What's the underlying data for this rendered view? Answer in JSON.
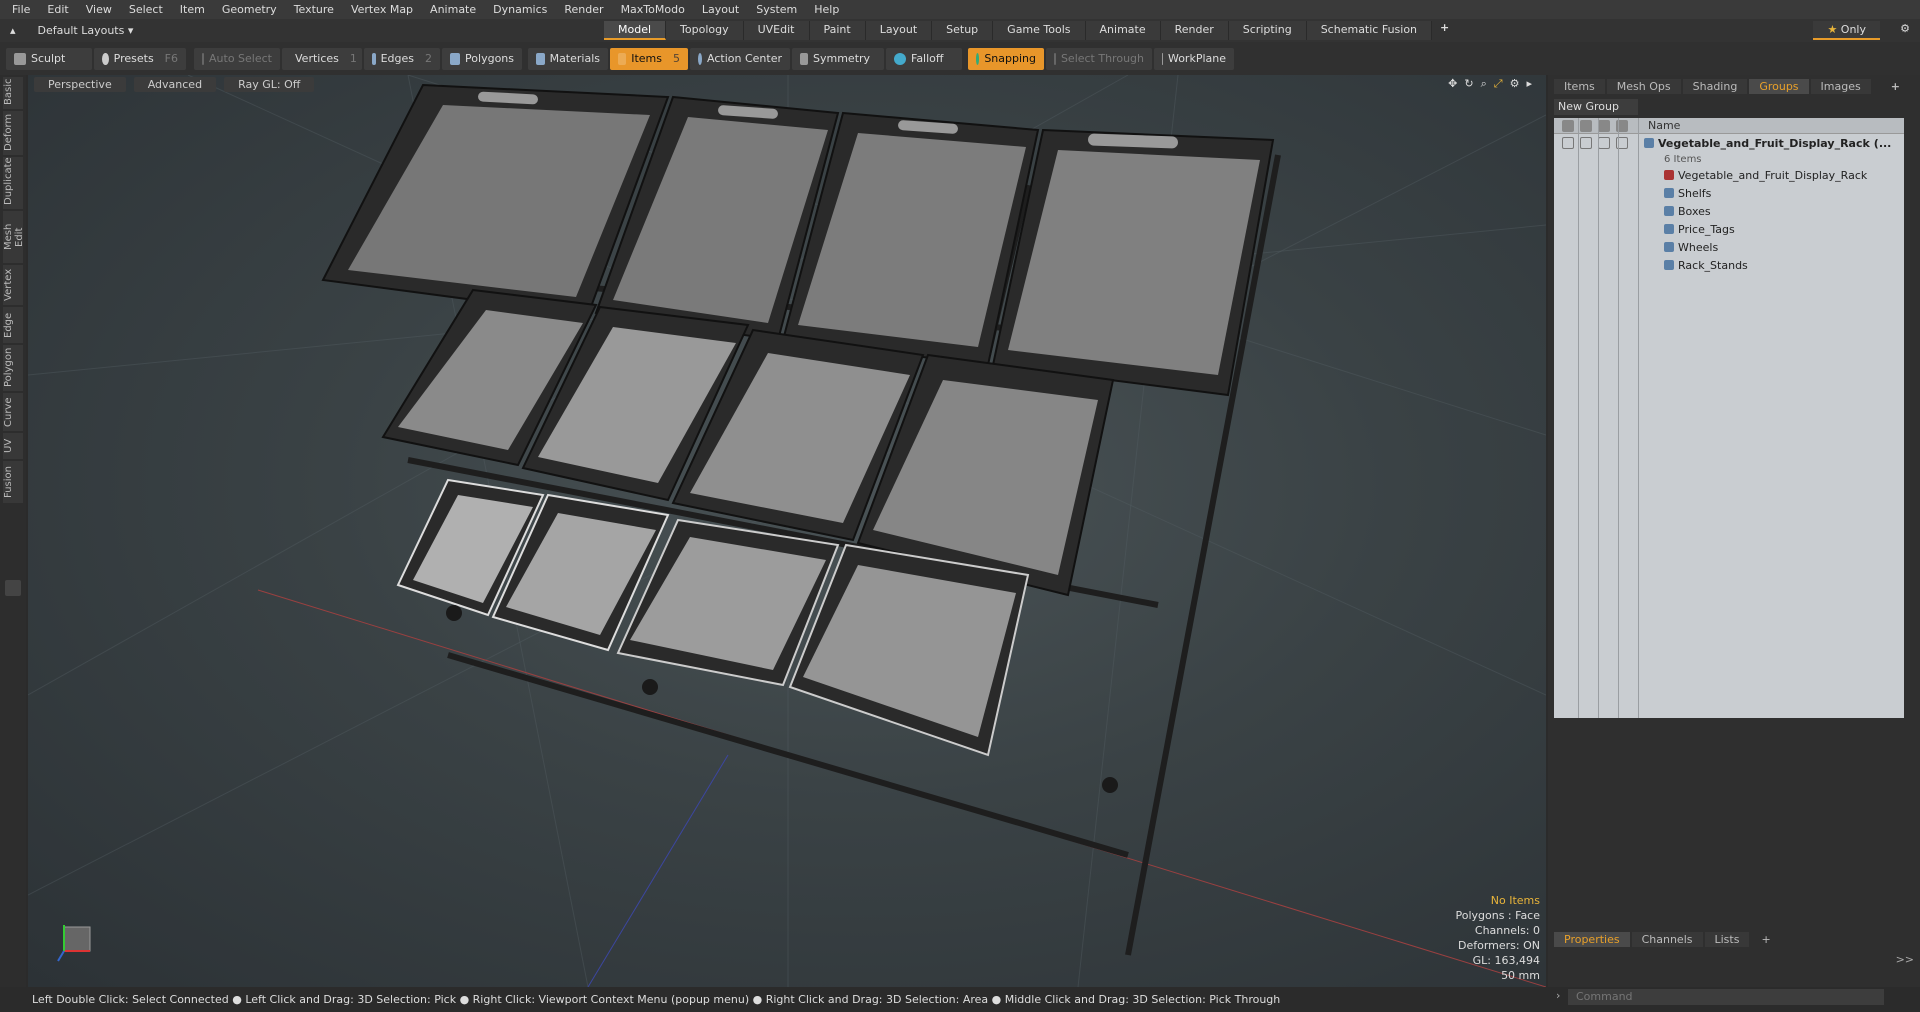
{
  "menu": [
    "File",
    "Edit",
    "View",
    "Select",
    "Item",
    "Geometry",
    "Texture",
    "Vertex Map",
    "Animate",
    "Dynamics",
    "Render",
    "MaxToModo",
    "Layout",
    "System",
    "Help"
  ],
  "layout_selector": "Default Layouts",
  "layout_tabs": [
    "Model",
    "Topology",
    "UVEdit",
    "Paint",
    "Layout",
    "Setup",
    "Game Tools",
    "Animate",
    "Render",
    "Scripting",
    "Schematic Fusion"
  ],
  "active_layout_tab": "Model",
  "only_button": "Only",
  "toolbar": [
    {
      "label": "Sculpt",
      "key": ""
    },
    {
      "label": "Presets",
      "key": "F6"
    },
    {
      "label": "Auto Select",
      "key": "",
      "dim": true
    },
    {
      "label": "Vertices",
      "key": "1"
    },
    {
      "label": "Edges",
      "key": "2"
    },
    {
      "label": "Polygons",
      "key": ""
    },
    {
      "label": "Materials",
      "key": ""
    },
    {
      "label": "Items",
      "key": "5",
      "active": true
    },
    {
      "label": "Action Center",
      "key": ""
    },
    {
      "label": "Symmetry",
      "key": ""
    },
    {
      "label": "Falloff",
      "key": ""
    },
    {
      "label": "Snapping",
      "key": "",
      "active": true
    },
    {
      "label": "Select Through",
      "key": "",
      "dim": true
    },
    {
      "label": "WorkPlane",
      "key": ""
    }
  ],
  "left_tabs": [
    "Basic",
    "Deform",
    "Duplicate",
    "Mesh Edit",
    "Vertex",
    "Edge",
    "Polygon",
    "Curve",
    "UV",
    "Fusion"
  ],
  "viewport": {
    "view": "Perspective",
    "shading": "Advanced",
    "raygl": "Ray GL: Off",
    "stats": {
      "items": "No Items",
      "polygons": "Polygons : Face",
      "channels": "Channels: 0",
      "deformers": "Deformers: ON",
      "gl": "GL: 163,494",
      "focal": "50 mm"
    }
  },
  "status_text": "Left Double Click: Select Connected ● Left Click and Drag: 3D Selection: Pick ● Right Click: Viewport Context Menu (popup menu) ● Right Click and Drag: 3D Selection: Area ● Middle Click and Drag: 3D Selection: Pick Through",
  "right_panel": {
    "tabs": [
      "Items",
      "Mesh Ops",
      "Shading",
      "Groups",
      "Images"
    ],
    "active_tab": "Groups",
    "new_group": "New Group",
    "name_header": "Name",
    "group_name": "Vegetable_and_Fruit_Display_Rack",
    "group_suffix": "(...",
    "item_count": "6 Items",
    "children": [
      "Vegetable_and_Fruit_Display_Rack",
      "Shelfs",
      "Boxes",
      "Price_Tags",
      "Wheels",
      "Rack_Stands"
    ],
    "bottom_tabs": [
      "Properties",
      "Channels",
      "Lists"
    ],
    "active_bottom_tab": "Properties",
    "command_placeholder": "Command"
  }
}
